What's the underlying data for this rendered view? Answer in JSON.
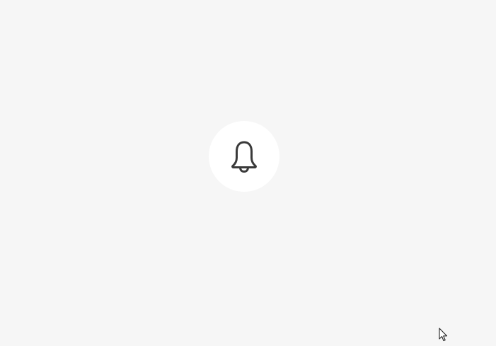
{
  "notifications_button": {
    "icon": "bell-icon",
    "background_color": "#ffffff",
    "icon_color": "#3a3a3a"
  },
  "page": {
    "background_color": "#f6f6f6"
  },
  "cursor": {
    "icon": "mouse-pointer-icon"
  }
}
